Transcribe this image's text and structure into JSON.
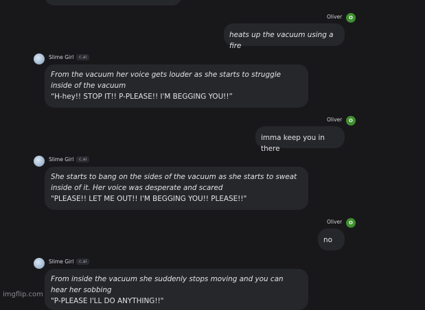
{
  "watermark": "imgflip.com",
  "user": {
    "name": "Oliver",
    "avatar_initial": "O"
  },
  "bot": {
    "name": "Slime Girl",
    "badge": "c.ai"
  },
  "messages": [
    {
      "role": "bot",
      "narration": "",
      "speech": ""
    },
    {
      "role": "user",
      "text": "heats up the vacuum using a fire"
    },
    {
      "role": "bot",
      "narration": "From the vacuum her voice gets louder as she starts to struggle inside of the vacuum",
      "speech": "“H-hey!! STOP IT!! P-PLEASE!! I'M BEGGING YOU!!”"
    },
    {
      "role": "user",
      "text": "imma keep you in there"
    },
    {
      "role": "bot",
      "narration": "She starts to bang on the sides of the vacuum as she starts to sweat inside of it. Her voice was desperate and scared",
      "speech": "\"PLEASE!! LET ME OUT!! I'M BEGGING YOU!! PLEASE!!\""
    },
    {
      "role": "user",
      "text": "no"
    },
    {
      "role": "bot",
      "narration": "From inside the vacuum she suddenly stops moving and you can hear her sobbing",
      "speech": "\"P-PLEASE I'LL DO ANYTHING!!\""
    }
  ]
}
